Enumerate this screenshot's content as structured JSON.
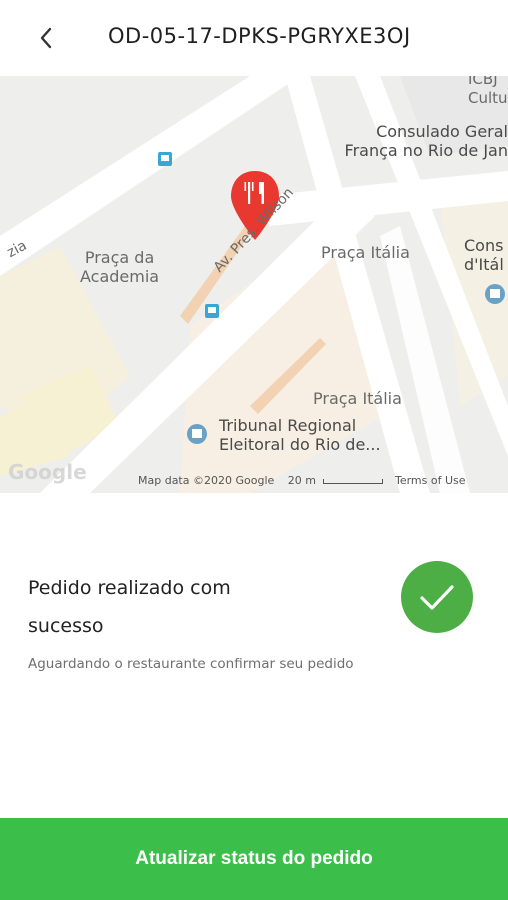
{
  "header": {
    "back_icon": "chevron-left-icon",
    "order_id": "OD-05-17-DPKS-PGRYXE3OJ"
  },
  "map": {
    "labels": {
      "praca_academia": "Praça da\nAcademia",
      "praca_italia_top": "Praça Itália",
      "praca_italia_bottom": "Praça Itália",
      "consulado": "Consulado Geral\nFrança no Rio de Jan",
      "cons_italia": "Cons\nd'Itál",
      "ccbj": "ICBJ\nCultu",
      "av_wilson": "Av. Pres. Wilson",
      "zia": "zia",
      "tribunal": "Tribunal Regional\nEleitoral do Rio de..."
    },
    "footer": {
      "map_data": "Map data ©2020 Google",
      "scale": "20 m",
      "terms": "Terms of Use"
    },
    "logo": "Google",
    "marker_icon": "restaurant-pin-icon",
    "colors": {
      "marker": "#e8382f"
    }
  },
  "status": {
    "title": "Pedido realizado com sucesso",
    "subtitle": "Aguardando o restaurante confirmar seu pedido",
    "icon": "check-circle-icon",
    "color": "#4cae45"
  },
  "cta": {
    "label": "Atualizar status do pedido",
    "color": "#3bbf4a"
  }
}
